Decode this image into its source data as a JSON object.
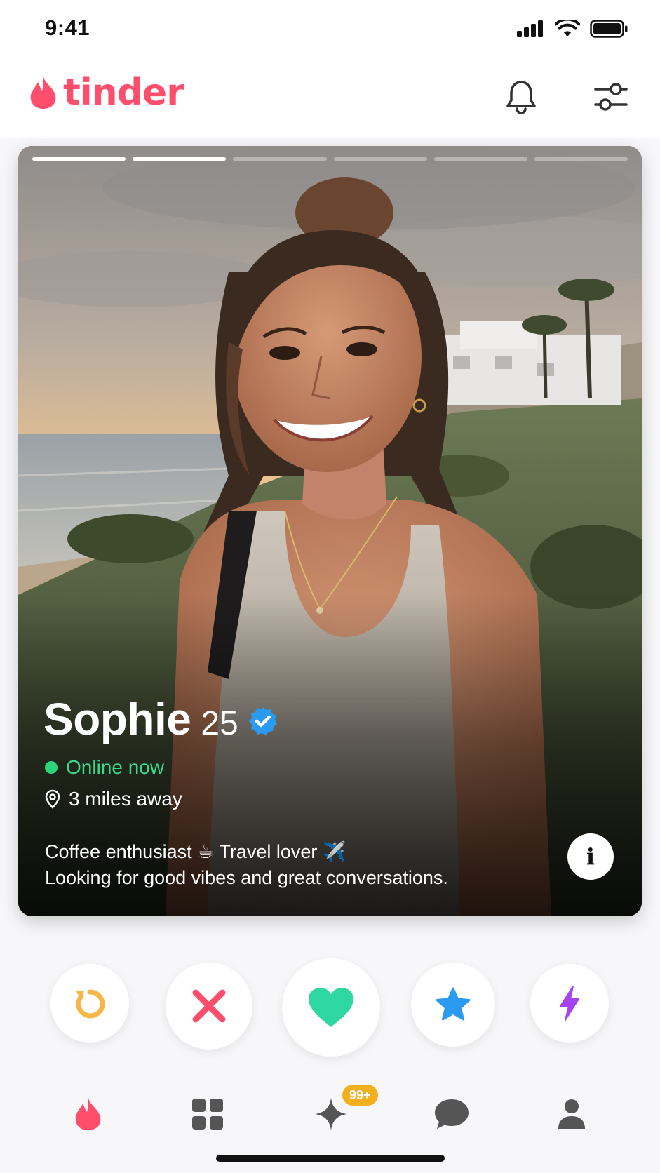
{
  "status_bar": {
    "time": "9:41"
  },
  "header": {
    "brand": "tinder"
  },
  "profile": {
    "name": "Sophie",
    "age": "25",
    "status": "Online now",
    "distance": "3 miles away",
    "bio_line1": "Coffee enthusiast ☕ Travel lover ✈️",
    "bio_line2": "Looking for good vibes and great conversations.",
    "photo_count": 6,
    "current_photo": 2,
    "info_label": "i"
  },
  "actions": [
    {
      "name": "rewind",
      "color": "#f5b748"
    },
    {
      "name": "nope",
      "color": "#fd4f6d"
    },
    {
      "name": "like",
      "color": "#2ed8a0"
    },
    {
      "name": "super-like",
      "color": "#2a9bf0"
    },
    {
      "name": "boost",
      "color": "#a544f0"
    }
  ],
  "bottom_nav": {
    "badge": "99+",
    "items": [
      "home",
      "explore",
      "likes",
      "messages",
      "profile"
    ]
  },
  "colors": {
    "brand": "#fd4f6d",
    "online": "#2ed47a",
    "badge": "#f2b01e",
    "verified": "#2a9bf0"
  }
}
